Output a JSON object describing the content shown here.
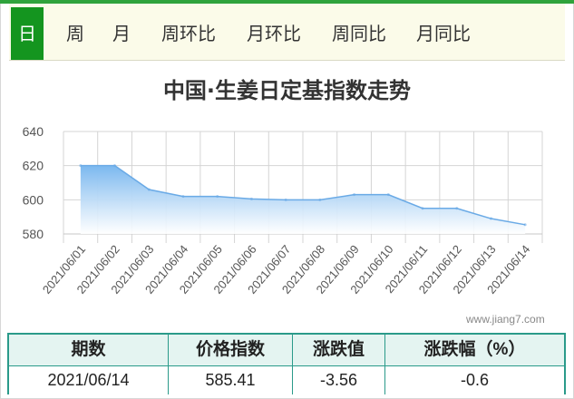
{
  "tabs": [
    {
      "label": "日",
      "active": true
    },
    {
      "label": "周",
      "active": false
    },
    {
      "label": "月",
      "active": false
    },
    {
      "label": "周环比",
      "active": false
    },
    {
      "label": "月环比",
      "active": false
    },
    {
      "label": "周同比",
      "active": false
    },
    {
      "label": "月同比",
      "active": false
    }
  ],
  "watermark": "www.jiang7.com",
  "table": {
    "headers": [
      "期数",
      "价格指数",
      "涨跌值",
      "涨跌幅（%）"
    ],
    "row": [
      "2021/06/14",
      "585.41",
      "-3.56",
      "-0.6"
    ]
  },
  "colors": {
    "accent": "#14951f",
    "tab_bg": "#fbfbe9",
    "area_top": "#7bb8ef",
    "area_bottom": "#ffffff",
    "table_border": "#2a9a8a",
    "table_head_bg": "#e4f4f1"
  },
  "chart_data": {
    "type": "area",
    "title": "中国·生姜日定基指数走势",
    "x": [
      "2021/06/01",
      "2021/06/02",
      "2021/06/03",
      "2021/06/04",
      "2021/06/05",
      "2021/06/06",
      "2021/06/07",
      "2021/06/08",
      "2021/06/09",
      "2021/06/10",
      "2021/06/11",
      "2021/06/12",
      "2021/06/13",
      "2021/06/14"
    ],
    "values": [
      620,
      620,
      606,
      602,
      602,
      600.5,
      600,
      600,
      603,
      603,
      595,
      595,
      589,
      585.41
    ],
    "ylim": [
      580,
      640
    ],
    "yticks": [
      580,
      600,
      620,
      640
    ],
    "grid": true,
    "legend": "none",
    "xlabel": "",
    "ylabel": ""
  }
}
